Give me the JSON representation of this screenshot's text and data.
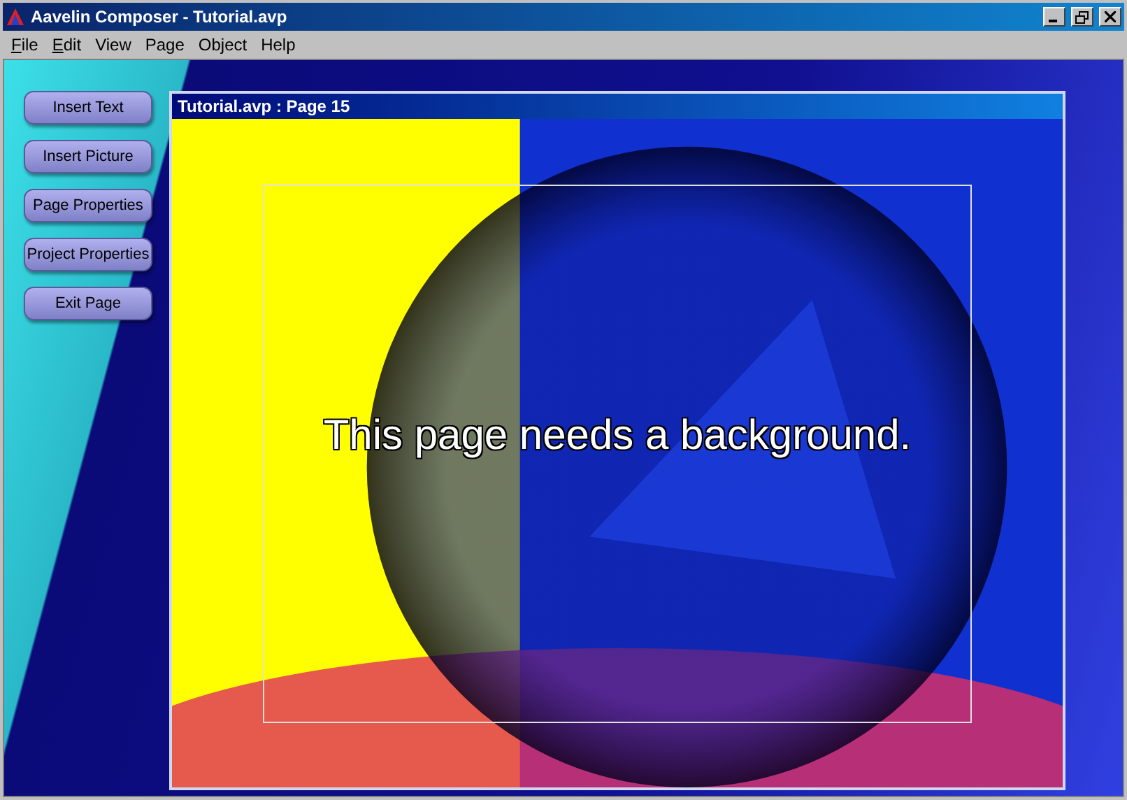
{
  "window": {
    "title": "Aavelin Composer - Tutorial.avp"
  },
  "menu": [
    {
      "label": "File",
      "mnemonic": true
    },
    {
      "label": "Edit",
      "mnemonic": true
    },
    {
      "label": "View",
      "mnemonic": false
    },
    {
      "label": "Page",
      "mnemonic": false
    },
    {
      "label": "Object",
      "mnemonic": false
    },
    {
      "label": "Help",
      "mnemonic": false
    }
  ],
  "sidebar_buttons": [
    "Insert Text",
    "Insert Picture",
    "Page Properties",
    "Project Properties",
    "Exit Page"
  ],
  "page_window": {
    "title": "Tutorial.avp : Page 15",
    "message": "This page needs a background."
  }
}
